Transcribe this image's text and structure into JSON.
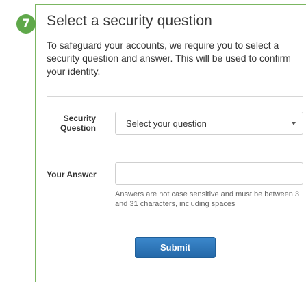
{
  "step": {
    "number": "7",
    "title": "Select a security question",
    "description": "To safeguard your accounts, we require you to select a security question and answer. This will be used to confirm your identity."
  },
  "form": {
    "security_question": {
      "label": "Security Question",
      "selected": "Select your question"
    },
    "answer": {
      "label": "Your Answer",
      "value": "",
      "hint": "Answers are not case sensitive and must be between 3 and 31 characters, including spaces"
    },
    "submit_label": "Submit"
  },
  "colors": {
    "accent_green": "#5fa84a",
    "button_blue": "#2f78bd"
  },
  "icons": {
    "select_arrow": "chevron-down-icon"
  }
}
